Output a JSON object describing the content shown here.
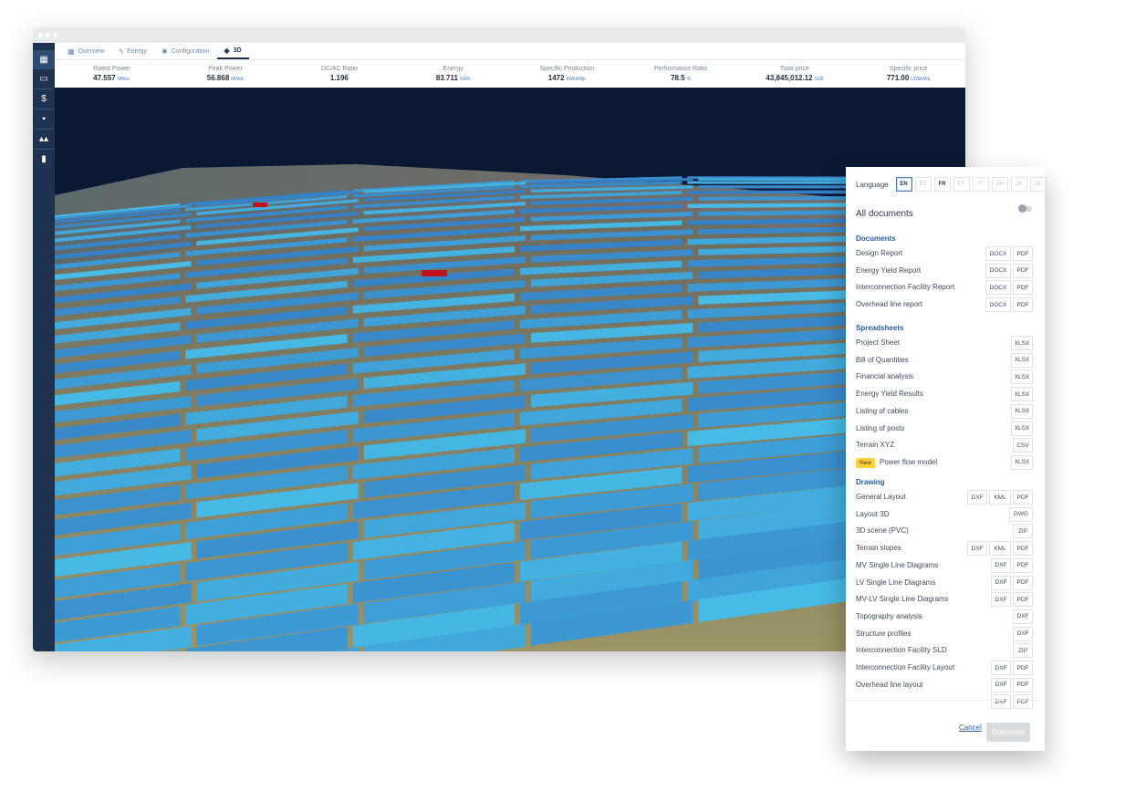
{
  "tabs": [
    {
      "label": "Overview",
      "icon": "map-icon"
    },
    {
      "label": "Energy",
      "icon": "bolt-icon"
    },
    {
      "label": "Configuration",
      "icon": "gear-icon"
    },
    {
      "label": "3D",
      "icon": "cube-icon"
    }
  ],
  "sidebar": [
    {
      "icon": "map-icon",
      "glyph": "▦"
    },
    {
      "icon": "monitor-icon",
      "glyph": "▭"
    },
    {
      "icon": "dollar-icon",
      "glyph": "$"
    },
    {
      "icon": "briefcase-icon",
      "glyph": "▪"
    },
    {
      "icon": "users-icon",
      "glyph": "▴▴"
    },
    {
      "icon": "bar-chart-icon",
      "glyph": "▮"
    }
  ],
  "metrics": [
    {
      "label": "Rated Power",
      "value": "47.557",
      "unit": "MWac"
    },
    {
      "label": "Peak Power",
      "value": "56.868",
      "unit": "MWdc"
    },
    {
      "label": "DC/AC Ratio",
      "value": "1.196",
      "unit": ""
    },
    {
      "label": "Energy",
      "value": "83.711",
      "unit": "GWh"
    },
    {
      "label": "Specific Production",
      "value": "1472",
      "unit": "kWh/kWp"
    },
    {
      "label": "Performance Ratio",
      "value": "78.5",
      "unit": "%"
    },
    {
      "label": "Total price",
      "value": "43,845,012.12",
      "unit": "US$"
    },
    {
      "label": "Specific price",
      "value": "771.00",
      "unit": "US$/kWp"
    }
  ],
  "panel": {
    "language_label": "Language",
    "languages": [
      "EN",
      "ES",
      "FR",
      "PT",
      "IT",
      "ZH",
      "JP",
      "DE"
    ],
    "active_language": "EN",
    "all_documents_label": "All documents",
    "sections": [
      {
        "title": "Documents",
        "items": [
          {
            "name": "Design Report",
            "formats": [
              "DOCX",
              "PDF"
            ]
          },
          {
            "name": "Energy Yield Report",
            "formats": [
              "DOCX",
              "PDF"
            ]
          },
          {
            "name": "Interconnection Facility Report",
            "formats": [
              "DOCX",
              "PDF"
            ]
          },
          {
            "name": "Overhead line report",
            "formats": [
              "DOCX",
              "PDF"
            ]
          }
        ]
      },
      {
        "title": "Spreadsheets",
        "items": [
          {
            "name": "Project Sheet",
            "formats": [
              "XLSX"
            ]
          },
          {
            "name": "Bill of Quantities",
            "formats": [
              "XLSX"
            ]
          },
          {
            "name": "Financial analysis",
            "formats": [
              "XLSX"
            ]
          },
          {
            "name": "Energy Yield Results",
            "formats": [
              "XLSX"
            ]
          },
          {
            "name": "Listing of cables",
            "formats": [
              "XLSX"
            ]
          },
          {
            "name": "Listing of posts",
            "formats": [
              "XLSX"
            ]
          },
          {
            "name": "Terrain XYZ",
            "formats": [
              "CSV"
            ]
          },
          {
            "name": "Power flow model",
            "formats": [
              "XLSX"
            ],
            "badge": "New"
          }
        ]
      },
      {
        "title": "Drawing",
        "items": [
          {
            "name": "General Layout",
            "formats": [
              "DXF",
              "KML",
              "PDF"
            ]
          },
          {
            "name": "Layout 3D",
            "formats": [
              "DWG"
            ]
          },
          {
            "name": "3D scene (PVC)",
            "formats": [
              "ZIP"
            ]
          },
          {
            "name": "Terrain slopes",
            "formats": [
              "DXF",
              "KML",
              "PDF"
            ]
          },
          {
            "name": "MV Single Line Diagrams",
            "formats": [
              "DXF",
              "PDF"
            ]
          },
          {
            "name": "LV Single Line Diagrams",
            "formats": [
              "DXF",
              "PDF"
            ]
          },
          {
            "name": "MV-LV Single Line Diagrams",
            "formats": [
              "DXF",
              "PDF"
            ]
          },
          {
            "name": "Topography analysis",
            "formats": [
              "DXF"
            ]
          },
          {
            "name": "Structure profiles",
            "formats": [
              "DXF"
            ]
          },
          {
            "name": "Interconnection Facility SLD",
            "formats": [
              "ZIP"
            ]
          },
          {
            "name": "Interconnection Facility Layout",
            "formats": [
              "DXF",
              "PDF"
            ]
          },
          {
            "name": "Overhead line layout",
            "formats": [
              "DXF",
              "PDF"
            ]
          }
        ]
      }
    ],
    "trailing_formats": [
      [
        "DXF",
        "PDF"
      ]
    ],
    "cancel_label": "Cancel",
    "download_label": "Download"
  },
  "colors": {
    "sidebar": "#1f3350",
    "sky": "#0b1833",
    "panel_bright": "#4fd8f5",
    "panel_dark": "#2f67b8",
    "ground": "#8a8a64",
    "transformer": "#c0141c",
    "accent": "#2b5a9a"
  }
}
